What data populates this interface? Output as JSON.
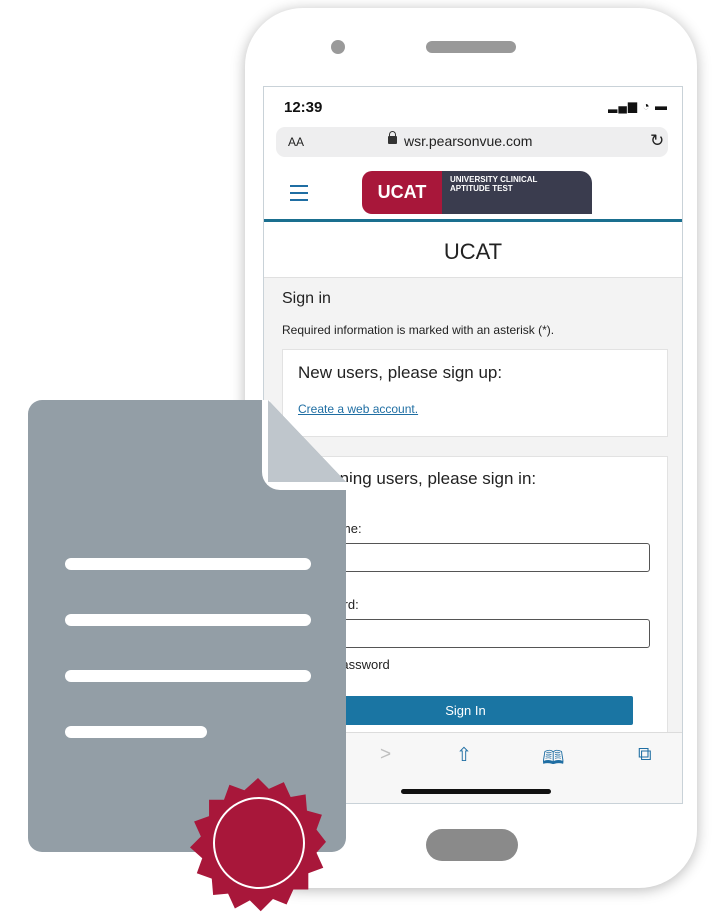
{
  "status": {
    "time": "12:39",
    "icons": "▂▄▆ ◔ ▬"
  },
  "browser": {
    "text_size": "AA",
    "url": "wsr.pearsonvue.com",
    "reload_glyph": "↻"
  },
  "logo": {
    "short": "UCAT",
    "full_line1": "UNIVERSITY CLINICAL",
    "full_line2": "APTITUDE TEST"
  },
  "page": {
    "title": "UCAT"
  },
  "signin": {
    "heading": "Sign in",
    "required_note": "Required information is marked with an asterisk (*).",
    "new_users": {
      "title": "New users, please sign up:",
      "link": "Create a web account."
    },
    "returning": {
      "title": "Returning users, please sign in:",
      "username_label": "Username:",
      "password_label": "Password:",
      "show_password": "Show password",
      "button": "Sign In"
    }
  },
  "toolbar": {
    "forward": ">",
    "share": "⇧",
    "bookmarks": "🕮",
    "tabs": "⧉"
  },
  "colors": {
    "brand_red": "#a8173a",
    "brand_dark": "#3a3c4e",
    "accent_blue": "#1a75a3",
    "doc_gray": "#939ea6"
  },
  "icons": [
    "hamburger-menu-icon",
    "lock-icon",
    "reload-icon",
    "forward-icon",
    "share-icon",
    "bookmarks-icon",
    "tabs-icon",
    "document-icon",
    "seal-icon"
  ]
}
